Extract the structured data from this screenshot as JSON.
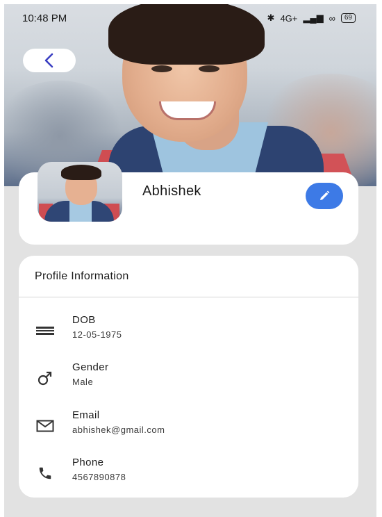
{
  "status_bar": {
    "time": "10:48 PM",
    "network": "4G+",
    "battery": "69"
  },
  "header": {
    "back_icon": "chevron-left-icon"
  },
  "profile": {
    "name": "Abhishek",
    "edit_icon": "pencil-icon",
    "accent_color": "#3d7ae6"
  },
  "info": {
    "title": "Profile Information",
    "rows": [
      {
        "label": "DOB",
        "value": "12-05-1975",
        "icon": "calendar-lines-icon"
      },
      {
        "label": "Gender",
        "value": "Male",
        "icon": "male-symbol-icon"
      },
      {
        "label": "Email",
        "value": "abhishek@gmail.com",
        "icon": "envelope-icon"
      },
      {
        "label": "Phone",
        "value": "4567890878",
        "icon": "phone-icon"
      }
    ]
  }
}
